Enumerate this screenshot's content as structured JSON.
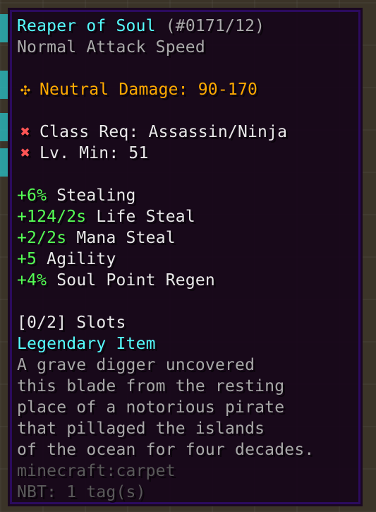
{
  "tooltip": {
    "title": "Reaper of Soul",
    "item_id": "(#0171/12)",
    "attack_speed": "Normal Attack Speed",
    "damage": {
      "icon": "neutral-damage-icon",
      "label": "Neutral Damage: 90-170"
    },
    "requirements": [
      {
        "icon": "red-x-icon",
        "label": "Class Req: Assassin/Ninja"
      },
      {
        "icon": "red-x-icon",
        "label": "Lv. Min: 51"
      }
    ],
    "identifications": [
      {
        "value": "+6%",
        "name": "Stealing"
      },
      {
        "value": "+124/2s",
        "name": "Life Steal"
      },
      {
        "value": "+2/2s",
        "name": "Mana Steal"
      },
      {
        "value": "+5",
        "name": "Agility"
      },
      {
        "value": "+4%",
        "name": "Soul Point Regen"
      }
    ],
    "slots": "[0/2] Slots",
    "tier": "Legendary Item",
    "lore": [
      "A grave digger uncovered",
      "this blade from the resting",
      "place of a notorious pirate",
      "that pillaged the islands",
      "of the ocean for four decades."
    ],
    "registry_name": "minecraft:carpet",
    "nbt": "NBT: 1 tag(s)"
  },
  "colors": {
    "title": "#55ffff",
    "damage": "#ffaa00",
    "requirement_fail": "#ff5555",
    "bonus_value": "#55ff55",
    "tier": "#55ffff",
    "lore": "#aaaaaa",
    "debug": "#555555"
  }
}
